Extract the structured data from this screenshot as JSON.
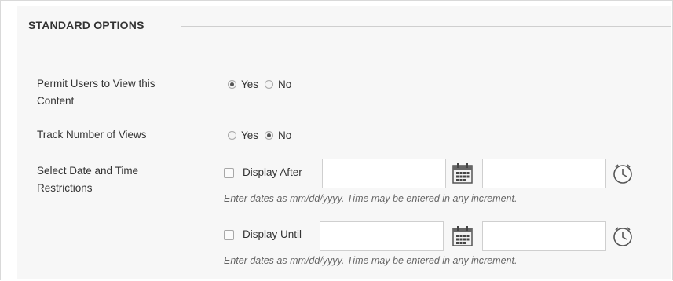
{
  "section": {
    "title": "STANDARD OPTIONS"
  },
  "permit_view": {
    "label": "Permit Users to View this Content",
    "options": [
      {
        "label": "Yes",
        "checked": true
      },
      {
        "label": "No",
        "checked": false
      }
    ]
  },
  "track_views": {
    "label": "Track Number of Views",
    "options": [
      {
        "label": "Yes",
        "checked": false
      },
      {
        "label": "No",
        "checked": true
      }
    ]
  },
  "date_restrictions": {
    "label": "Select Date and Time Restrictions",
    "display_after": {
      "label": "Display After",
      "checked": false,
      "date_value": "",
      "time_value": "",
      "hint": "Enter dates as mm/dd/yyyy. Time may be entered in any increment."
    },
    "display_until": {
      "label": "Display Until",
      "checked": false,
      "date_value": "",
      "time_value": "",
      "hint": "Enter dates as mm/dd/yyyy. Time may be entered in any increment."
    }
  },
  "icons": {
    "calendar": "calendar-icon",
    "clock": "clock-icon"
  }
}
